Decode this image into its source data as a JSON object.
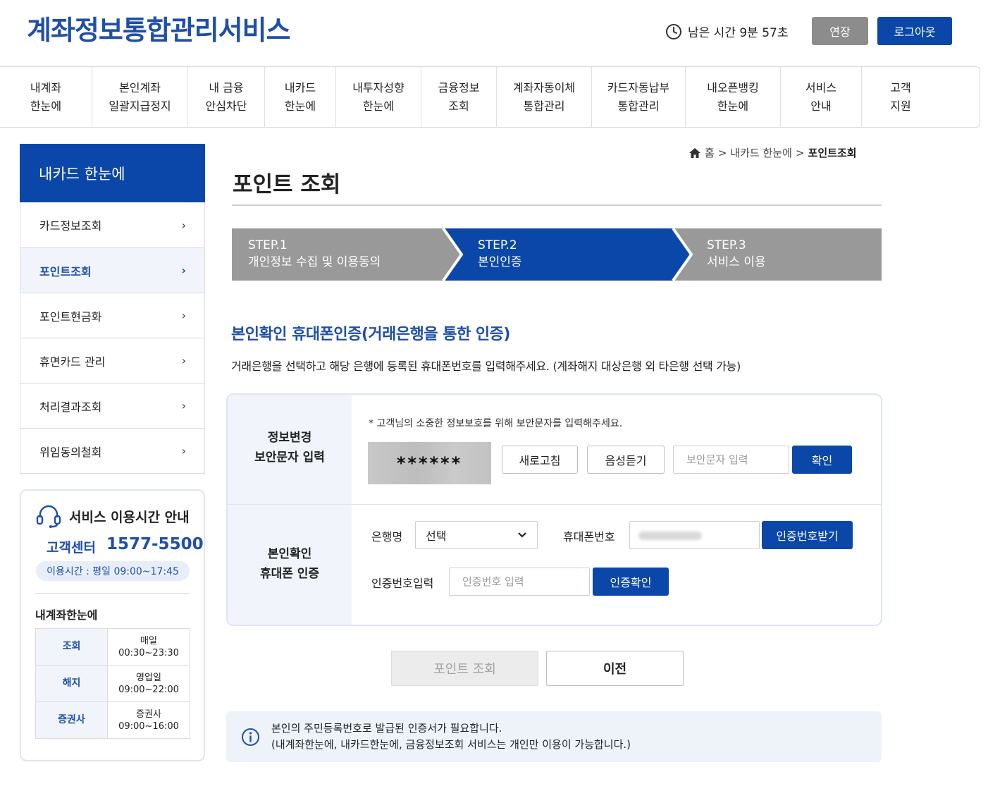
{
  "header": {
    "logo": "계좌정보통합관리서비스",
    "timer_text": "남은 시간 9분 57초",
    "extend_label": "연장",
    "logout_label": "로그아웃"
  },
  "nav": {
    "items": [
      "내계좌\n한눈에",
      "본인계좌\n일괄지급정지",
      "내 금융\n안심차단",
      "내카드\n한눈에",
      "내투자성향\n한눈에",
      "금융정보\n조회",
      "계좌자동이체\n통합관리",
      "카드자동납부\n통합관리",
      "내오픈뱅킹\n한눈에",
      "서비스\n안내",
      "고객\n지원"
    ]
  },
  "sidebar": {
    "title": "내카드 한눈에",
    "items": [
      {
        "label": "카드정보조회",
        "active": false
      },
      {
        "label": "포인트조회",
        "active": true
      },
      {
        "label": "포인트현금화",
        "active": false
      },
      {
        "label": "휴면카드 관리",
        "active": false
      },
      {
        "label": "처리결과조회",
        "active": false
      },
      {
        "label": "위임동의철회",
        "active": false
      }
    ],
    "chevron": "›"
  },
  "service_info": {
    "title": "서비스 이용시간 안내",
    "cc_label": "고객센터",
    "cc_number": "1577-5500",
    "hours": "이용시간 : 평일 09:00~17:45",
    "subtitle": "내계좌한눈에",
    "table": [
      {
        "k": "조회",
        "v": "매일\n00:30~23:30"
      },
      {
        "k": "해지",
        "v": "영업일\n09:00~22:00"
      },
      {
        "k": "증권사",
        "v": "증권사\n09:00~16:00"
      }
    ]
  },
  "breadcrumb": {
    "home": "홈",
    "parent": "내카드 한눈에",
    "current": "포인트조회",
    "sep": ">"
  },
  "page": {
    "title": "포인트 조회"
  },
  "steps": [
    {
      "num": "STEP.1",
      "label": "개인정보 수집 및 이용동의",
      "active": false
    },
    {
      "num": "STEP.2",
      "label": "본인인증",
      "active": true
    },
    {
      "num": "STEP.3",
      "label": "서비스 이용",
      "active": false
    }
  ],
  "section": {
    "title": "본인확인 휴대폰인증(거래은행을 통한 인증)",
    "desc": "거래은행을 선택하고 해당 은행에 등록된 휴대폰번호를 입력해주세요. (계좌해지 대상은행 외 타은행 선택 가능)"
  },
  "captcha_row": {
    "label": "정보변경\n보안문자 입력",
    "notice": "* 고객님의 소중한 정보보호를 위해 보안문자를 입력해주세요.",
    "captcha_text": "******",
    "refresh_label": "새로고침",
    "audio_label": "음성듣기",
    "input_placeholder": "보안문자 입력",
    "confirm_label": "확인"
  },
  "auth_row": {
    "label": "본인확인\n휴대폰 인증",
    "bank_label": "은행명",
    "bank_selected": "선택",
    "phone_label": "휴대폰번호",
    "request_label": "인증번호받기",
    "code_label": "인증번호입력",
    "code_placeholder": "인증번호 입력",
    "verify_label": "인증확인"
  },
  "actions": {
    "submit_label": "포인트 조회",
    "prev_label": "이전"
  },
  "notice": {
    "line1": "본인의 주민등록번호로 발급된 인증서가 필요합니다.",
    "line2": "(내계좌한눈에, 내카드한눈에, 금융정보조회 서비스는 개인만 이용이 가능합니다.)"
  },
  "colors": {
    "primary": "#0b47a8",
    "step_inactive": "#999999",
    "label_bg": "#f1f5fb"
  }
}
